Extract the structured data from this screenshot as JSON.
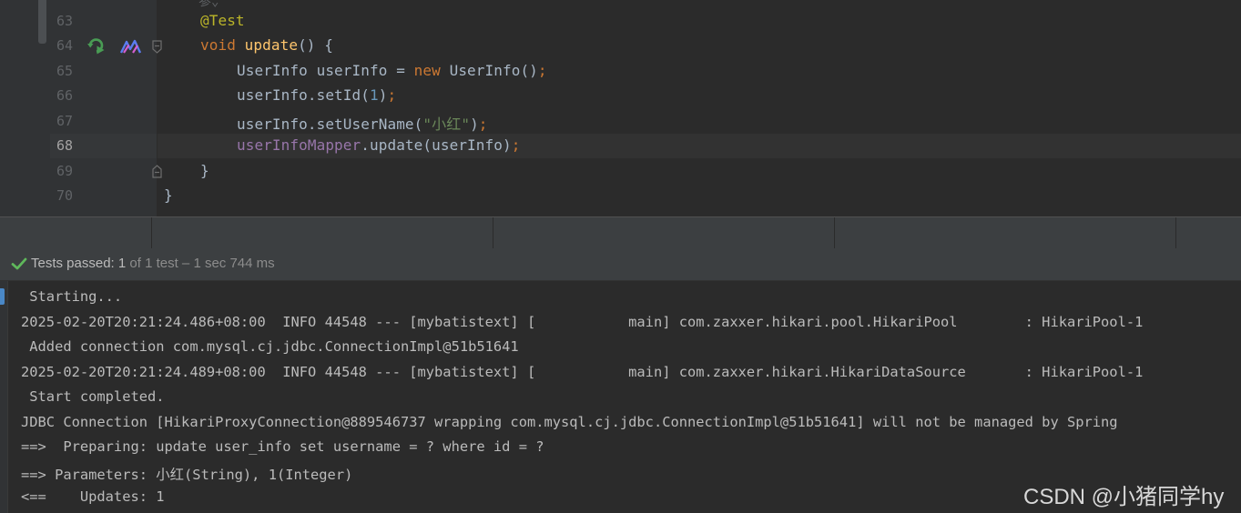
{
  "editor": {
    "partial_top_text": "参⌄",
    "lines": [
      {
        "num": "63",
        "annotation": "@Test"
      },
      {
        "num": "64",
        "kw": "void",
        "method": "update",
        "rest": "() {"
      },
      {
        "num": "65",
        "type_decl": "UserInfo userInfo = ",
        "kw": "new",
        "ctor": " UserInfo()",
        "semi": ";"
      },
      {
        "num": "66",
        "call": "userInfo.setId(",
        "arg": "1",
        "close": ")",
        "semi": ";"
      },
      {
        "num": "67",
        "call": "userInfo.setUserName(",
        "arg": "\"小红\"",
        "close": ")",
        "semi": ";"
      },
      {
        "num": "68",
        "field": "userInfoMapper",
        "call": ".update(userInfo)",
        "semi": ";"
      },
      {
        "num": "69",
        "text": "}"
      },
      {
        "num": "70",
        "text": "}"
      }
    ]
  },
  "test_status": {
    "label": "Tests passed: 1",
    "detail": " of 1 test – 1 sec 744 ms"
  },
  "console": {
    "lines": [
      " Starting...",
      "2025-02-20T20:21:24.486+08:00  INFO 44548 --- [mybatistext] [           main] com.zaxxer.hikari.pool.HikariPool        : HikariPool-1",
      " Added connection com.mysql.cj.jdbc.ConnectionImpl@51b51641",
      "2025-02-20T20:21:24.489+08:00  INFO 44548 --- [mybatistext] [           main] com.zaxxer.hikari.HikariDataSource       : HikariPool-1",
      " Start completed.",
      "JDBC Connection [HikariProxyConnection@889546737 wrapping com.mysql.cj.jdbc.ConnectionImpl@51b51641] will not be managed by Spring",
      "==>  Preparing: update user_info set username = ? where id = ?",
      "==> Parameters: 小红(String), 1(Integer)",
      "<==    Updates: 1"
    ]
  },
  "watermark": "CSDN @小猪同学hy"
}
